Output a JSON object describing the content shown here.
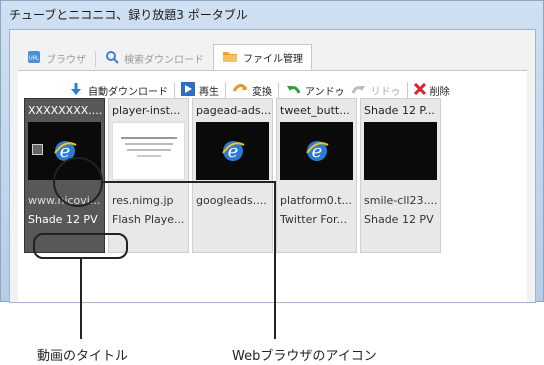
{
  "window": {
    "title": "チューブとニコニコ、録り放題3 ポータブル"
  },
  "tabs": [
    {
      "label": "ブラウザ",
      "active": false
    },
    {
      "label": "検索ダウンロード",
      "active": false
    },
    {
      "label": "ファイル管理",
      "active": true
    }
  ],
  "toolbar": {
    "auto_download": "自動ダウンロード",
    "play": "再生",
    "convert": "変換",
    "undo": "アンドゥ",
    "redo": "リドゥ",
    "delete": "削除"
  },
  "cards": [
    {
      "title": "XXXXXXXX....",
      "url": "www.nicovi...",
      "author": "Shade 12 PV",
      "thumb": "ie-black",
      "selected": true
    },
    {
      "title": "player-inst...",
      "url": "res.nimg.jp",
      "author": "Flash Playe...",
      "thumb": "doc-white",
      "selected": false
    },
    {
      "title": "pagead-ads...",
      "url": "googleads....",
      "author": "",
      "thumb": "ie-black",
      "selected": false
    },
    {
      "title": "tweet_butt...",
      "url": "platform0.t...",
      "author": "Twitter For...",
      "thumb": "ie-black",
      "selected": false
    },
    {
      "title": "Shade 12 P...",
      "url": "smile-cll23....",
      "author": "Shade 12 PV",
      "thumb": "black",
      "selected": false
    }
  ],
  "callouts": {
    "video_title": "動画のタイトル",
    "browser_icon": "Webブラウザのアイコン"
  },
  "colors": {
    "accent": "#1a73c8",
    "selected_card": "#585858",
    "delete_red": "#d9252a",
    "undo_green": "#2e9e3c"
  }
}
